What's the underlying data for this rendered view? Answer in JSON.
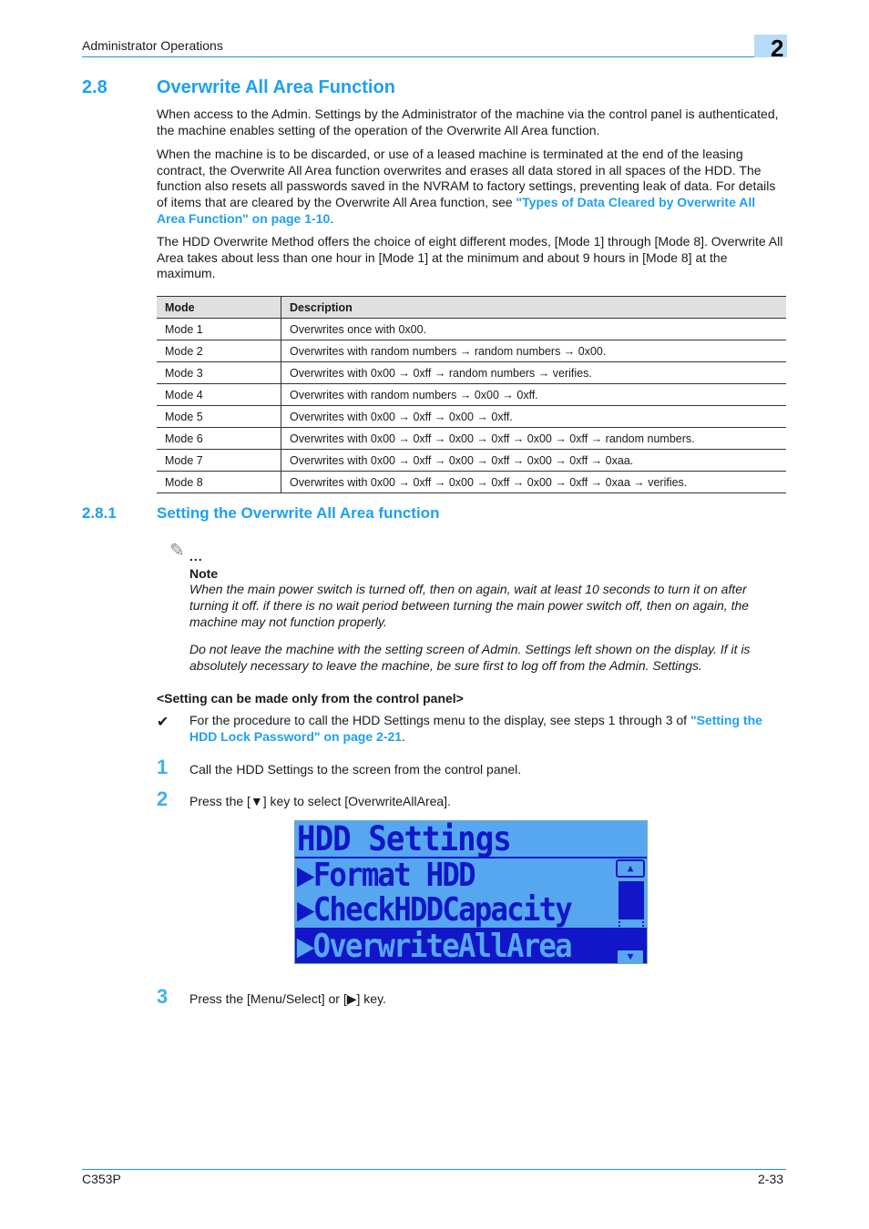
{
  "header": {
    "section_title": "Administrator Operations",
    "chapter_number": "2"
  },
  "section": {
    "number": "2.8",
    "title": "Overwrite All Area Function",
    "paragraphs": [
      "When access to the Admin. Settings by the Administrator of the machine via the control panel is authenticated, the machine enables setting of the operation of the Overwrite All Area function.",
      "When the machine is to be discarded, or use of a leased machine is terminated at the end of the leasing contract, the Overwrite All Area function overwrites and erases all data stored in all spaces of the HDD. The function also resets all passwords saved in the NVRAM to factory settings, preventing leak of data. For details of items that are cleared by the Overwrite All Area function, see ",
      "The HDD Overwrite Method offers the choice of eight different modes, [Mode 1] through [Mode 8]. Overwrite All Area takes about less than one hour in [Mode 1] at the minimum and about 9 hours in [Mode 8] at the maximum."
    ],
    "link_types_of_data": "\"Types of Data Cleared by Overwrite All Area Function\" on page 1-10",
    "para2_end": "."
  },
  "mode_table": {
    "headers": [
      "Mode",
      "Description"
    ],
    "rows": [
      [
        "Mode 1",
        "Overwrites once with 0x00."
      ],
      [
        "Mode 2",
        "Overwrites with random numbers → random numbers → 0x00."
      ],
      [
        "Mode 3",
        "Overwrites with 0x00 → 0xff → random numbers → verifies."
      ],
      [
        "Mode 4",
        "Overwrites with random numbers → 0x00 → 0xff."
      ],
      [
        "Mode 5",
        "Overwrites with 0x00 → 0xff → 0x00 → 0xff."
      ],
      [
        "Mode 6",
        "Overwrites with 0x00 → 0xff → 0x00 → 0xff → 0x00 → 0xff → random numbers."
      ],
      [
        "Mode 7",
        "Overwrites with 0x00 → 0xff → 0x00 → 0xff → 0x00 → 0xff → 0xaa."
      ],
      [
        "Mode 8",
        "Overwrites with 0x00 → 0xff → 0x00 → 0xff → 0x00 → 0xff → 0xaa → verifies."
      ]
    ]
  },
  "subsection": {
    "number": "2.8.1",
    "title": "Setting the Overwrite All Area function",
    "note_icon": "pencil-note-icon",
    "note_dots": "...",
    "note_label": "Note",
    "note_paragraphs": [
      "When the main power switch is turned off, then on again, wait at least 10 seconds to turn it on after turning it off. if there is no wait period between turning the main power switch off, then on again, the machine may not function properly.",
      "Do not leave the machine with the setting screen of Admin. Settings left shown on the display. If it is absolutely necessary to leave the machine, be sure first to log off from the Admin. Settings."
    ],
    "procedure_heading": "<Setting can be made only from the control panel>",
    "check_mark": "✔",
    "check_text": "For the procedure to call the HDD Settings menu to the display, see steps 1 through 3 of ",
    "check_link": "\"Setting the HDD Lock Password\" on page 2-21",
    "check_end": ".",
    "steps": [
      {
        "num": "1",
        "text": "Call the HDD Settings to the screen from the control panel."
      },
      {
        "num": "2",
        "text": "Press the [▼] key to select [OverwriteAllArea]."
      },
      {
        "num": "3",
        "text": "Press the [Menu/Select] or [▶] key."
      }
    ]
  },
  "lcd_screen": {
    "title": "HDD Settings",
    "items": [
      {
        "label": "▶Format HDD",
        "selected": false
      },
      {
        "label": "▶CheckHDDCapacity",
        "selected": false
      },
      {
        "label": "▶OverwriteAllArea",
        "selected": true
      }
    ],
    "scroll_up": "▲",
    "scroll_down": "▼",
    "colors": {
      "background": "#56a7ef",
      "foreground": "#1216c8"
    }
  },
  "footer": {
    "model": "C353P",
    "page": "2-33"
  }
}
